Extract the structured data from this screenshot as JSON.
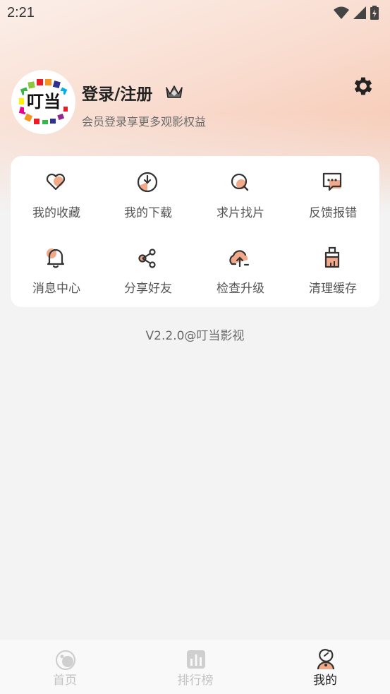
{
  "status_bar": {
    "time": "2:21"
  },
  "profile": {
    "avatar_text": "叮当",
    "login_title": "登录/注册",
    "subtitle": "会员登录享更多观影权益"
  },
  "grid": {
    "items": [
      {
        "label": "我的收藏",
        "icon": "heart-icon"
      },
      {
        "label": "我的下载",
        "icon": "download-icon"
      },
      {
        "label": "求片找片",
        "icon": "search-icon"
      },
      {
        "label": "反馈报错",
        "icon": "feedback-icon"
      },
      {
        "label": "消息中心",
        "icon": "bell-icon"
      },
      {
        "label": "分享好友",
        "icon": "share-icon"
      },
      {
        "label": "检查升级",
        "icon": "cloud-upload-icon"
      },
      {
        "label": "清理缓存",
        "icon": "broom-icon"
      }
    ]
  },
  "version": "V2.2.0@叮当影视",
  "tabs": [
    {
      "label": "首页",
      "active": false
    },
    {
      "label": "排行榜",
      "active": false
    },
    {
      "label": "我的",
      "active": true
    }
  ],
  "colors": {
    "accent": "#f2a98a",
    "icon_stroke": "#333333",
    "inactive_tab": "#c3c3c3"
  }
}
